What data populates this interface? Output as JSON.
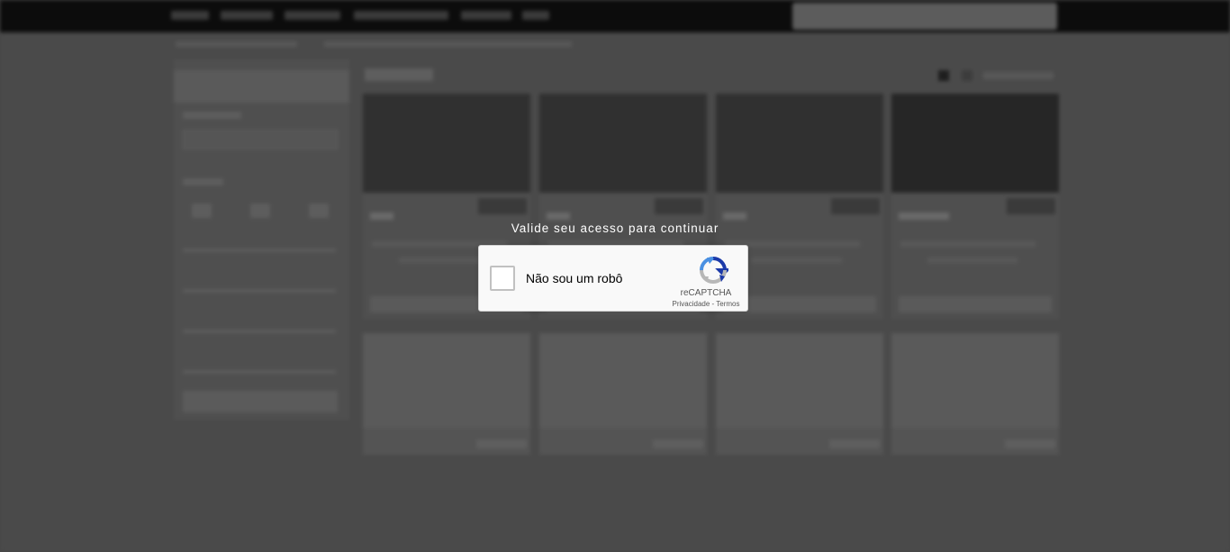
{
  "overlay": {
    "prompt": "Valide seu acesso para continuar"
  },
  "recaptcha": {
    "checkbox_label": "Não sou um robô",
    "brand": "reCAPTCHA",
    "privacy_link": "Privacidade",
    "separator": "-",
    "terms_link": "Termos",
    "logo_icon": "recaptcha-logo-icon",
    "colors": {
      "blue": "#4a90e2",
      "dark_blue": "#1c3aa9",
      "gray": "#b7b7b7"
    }
  }
}
